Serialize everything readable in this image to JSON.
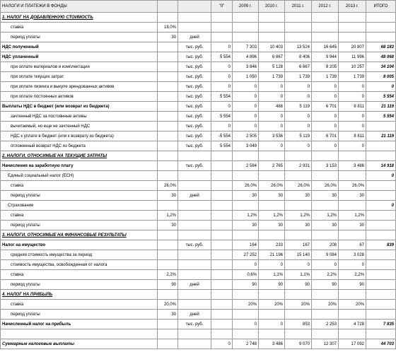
{
  "header": [
    "НАЛОГИ И ПЛАТЕЖИ В ФОНДЫ",
    "",
    "",
    "\"0\"",
    "2009 г.",
    "2010 г.",
    "2011 г.",
    "2012 г.",
    "2013 г.",
    "ИТОГО"
  ],
  "rows": [
    {
      "style": "sec",
      "cells": [
        "1. НАЛОГ НА ДОБАВЛЕННУЮ СТОИМОСТЬ",
        "",
        "",
        "",
        "",
        "",
        "",
        "",
        "",
        ""
      ]
    },
    {
      "style": "",
      "cells": [
        "ставка",
        "18,0%",
        "",
        "",
        "",
        "",
        "",
        "",
        "",
        ""
      ]
    },
    {
      "style": "",
      "cells": [
        "период уплаты",
        "30",
        "дней",
        "",
        "",
        "",
        "",
        "",
        "",
        ""
      ]
    },
    {
      "style": "",
      "cells": [
        "НДС полученный",
        "",
        "тыс. руб.",
        "0",
        "7 303",
        "10 403",
        "13 524",
        "16 645",
        "20 807",
        "68 183"
      ]
    },
    {
      "style": "",
      "cells": [
        "НДС уплаченный",
        "",
        "тыс. руб.",
        "5 554",
        "4 896",
        "6 867",
        "8 406",
        "9 944",
        "11 996",
        "48 068"
      ]
    },
    {
      "style": "",
      "cells": [
        "при оплате материалов и комплектации",
        "",
        "тыс. руб.",
        "0",
        "3 846",
        "5 128",
        "6 667",
        "8 205",
        "10 257",
        "34 104"
      ]
    },
    {
      "style": "",
      "cells": [
        "при оплате текущих затрат",
        "",
        "тыс. руб.",
        "0",
        "1 050",
        "1 739",
        "1 739",
        "1 739",
        "1 739",
        "8 005"
      ]
    },
    {
      "style": "",
      "cells": [
        "при оплате лизинга и выкупе арендованных активов",
        "",
        "тыс. руб.",
        "0",
        "0",
        "0",
        "0",
        "0",
        "0",
        "0"
      ]
    },
    {
      "style": "",
      "cells": [
        "при оплате постоянных активов",
        "",
        "тыс. руб.",
        "5 554",
        "0",
        "0",
        "0",
        "0",
        "0",
        "5 554"
      ]
    },
    {
      "style": "",
      "cells": [
        "Выплаты НДС в бюджет (или возврат из бюджета)",
        "",
        "тыс. руб.",
        "0",
        "0",
        "488",
        "5 119",
        "6 701",
        "8 811",
        "21 119"
      ]
    },
    {
      "style": "",
      "cells": [
        "зачтенный НДС за постоянные активы",
        "",
        "тыс. руб.",
        "5 554",
        "0",
        "0",
        "0",
        "0",
        "0",
        "5 554"
      ]
    },
    {
      "style": "",
      "cells": [
        "вычитаемый, но еще не зачтенный НДС",
        "",
        "тыс. руб.",
        "0",
        "0",
        "0",
        "0",
        "0",
        "0",
        ""
      ]
    },
    {
      "style": "",
      "cells": [
        "НДС к уплате в бюджет (или к возврату из бюджета)",
        "",
        "тыс. руб.",
        "-5 554",
        "2 505",
        "3 536",
        "5 119",
        "6 701",
        "8 811",
        "21 119"
      ]
    },
    {
      "style": "",
      "cells": [
        "отложенный возврат НДС из бюджета",
        "",
        "тыс. руб.",
        "5 554",
        "3 049",
        "0",
        "0",
        "0",
        "0",
        ""
      ]
    },
    {
      "style": "sec",
      "cells": [
        "2. НАЛОГИ, ОТНОСИМЫЕ НА ТЕКУЩИЕ ЗАТРАТЫ",
        "",
        "",
        "",
        "",
        "",
        "",
        "",
        "",
        ""
      ]
    },
    {
      "style": "",
      "cells": [
        "Начисления на заработную плату",
        "",
        "тыс. руб.",
        "",
        "2 584",
        "2 765",
        "2 931",
        "3 153",
        "3 486",
        "14 918"
      ]
    },
    {
      "style": "",
      "cells": [
        "Единый социальный налог (ЕСН)",
        "",
        "",
        "",
        "",
        "",
        "",
        "",
        "",
        "0"
      ]
    },
    {
      "style": "",
      "cells": [
        "ставка",
        "26,0%",
        "",
        "",
        "26,0%",
        "26,0%",
        "26,0%",
        "26,0%",
        "26,0%",
        ""
      ]
    },
    {
      "style": "",
      "cells": [
        "период уплаты",
        "30",
        "дней",
        "",
        "30",
        "30",
        "30",
        "30",
        "30",
        ""
      ]
    },
    {
      "style": "",
      "cells": [
        "Страхование",
        "",
        "",
        "",
        "",
        "",
        "",
        "",
        "",
        "0"
      ]
    },
    {
      "style": "",
      "cells": [
        "ставка",
        "1,2%",
        "",
        "",
        "1,2%",
        "1,2%",
        "1,2%",
        "1,2%",
        "1,2%",
        ""
      ]
    },
    {
      "style": "",
      "cells": [
        "период уплаты",
        "30",
        "",
        "",
        "30",
        "30",
        "30",
        "30",
        "30",
        ""
      ]
    },
    {
      "style": "sec",
      "cells": [
        "3. НАЛОГИ, ОТНОСИМЫЕ НА ФИНАНСОВЫЕ РЕЗУЛЬТАТЫ",
        "",
        "",
        "",
        "",
        "",
        "",
        "",
        "",
        ""
      ]
    },
    {
      "style": "",
      "cells": [
        "Налог на имущество",
        "",
        "тыс. руб.",
        "",
        "164",
        "233",
        "167",
        "208",
        "67",
        "839"
      ]
    },
    {
      "style": "",
      "cells": [
        "средняя стоимость имущества за период",
        "",
        "",
        "",
        "27 252",
        "21 196",
        "15 140",
        "9 084",
        "3 028",
        ""
      ]
    },
    {
      "style": "",
      "cells": [
        "стоимость имущества, освобожденная от налога",
        "",
        "",
        "",
        "0",
        "0",
        "0",
        "0",
        "0",
        ""
      ]
    },
    {
      "style": "",
      "cells": [
        "ставка",
        "2,2%",
        "",
        "",
        "0,6%",
        "1,1%",
        "1,1%",
        "2,2%",
        "2,2%",
        ""
      ]
    },
    {
      "style": "",
      "cells": [
        "период уплаты",
        "90",
        "дней",
        "",
        "90",
        "90",
        "90",
        "90",
        "90",
        ""
      ]
    },
    {
      "style": "sec",
      "cells": [
        "4. НАЛОГ НА ПРИБЫЛЬ",
        "",
        "",
        "",
        "",
        "",
        "",
        "",
        "",
        ""
      ]
    },
    {
      "style": "",
      "cells": [
        "ставка",
        "20,0%",
        "",
        "",
        "20%",
        "20%",
        "20%",
        "20%",
        "20%",
        ""
      ]
    },
    {
      "style": "",
      "cells": [
        "период уплаты",
        "30",
        "дней",
        "",
        "",
        "",
        "",
        "",
        "",
        ""
      ]
    },
    {
      "style": "",
      "cells": [
        "Начисленный налог на прибыль",
        "",
        "тыс. руб.",
        "",
        "0",
        "0",
        "853",
        "2 253",
        "4 728",
        "7 835"
      ]
    },
    {
      "style": "",
      "cells": [
        "",
        "",
        "",
        "",
        "",
        "",
        "",
        "",
        "",
        ""
      ]
    },
    {
      "style": "",
      "cells": [
        "Суммарные налоговые выплаты",
        "",
        "",
        "0",
        "2 748",
        "3 486",
        "9 070",
        "12 307",
        "17 092",
        "44 703"
      ]
    }
  ]
}
